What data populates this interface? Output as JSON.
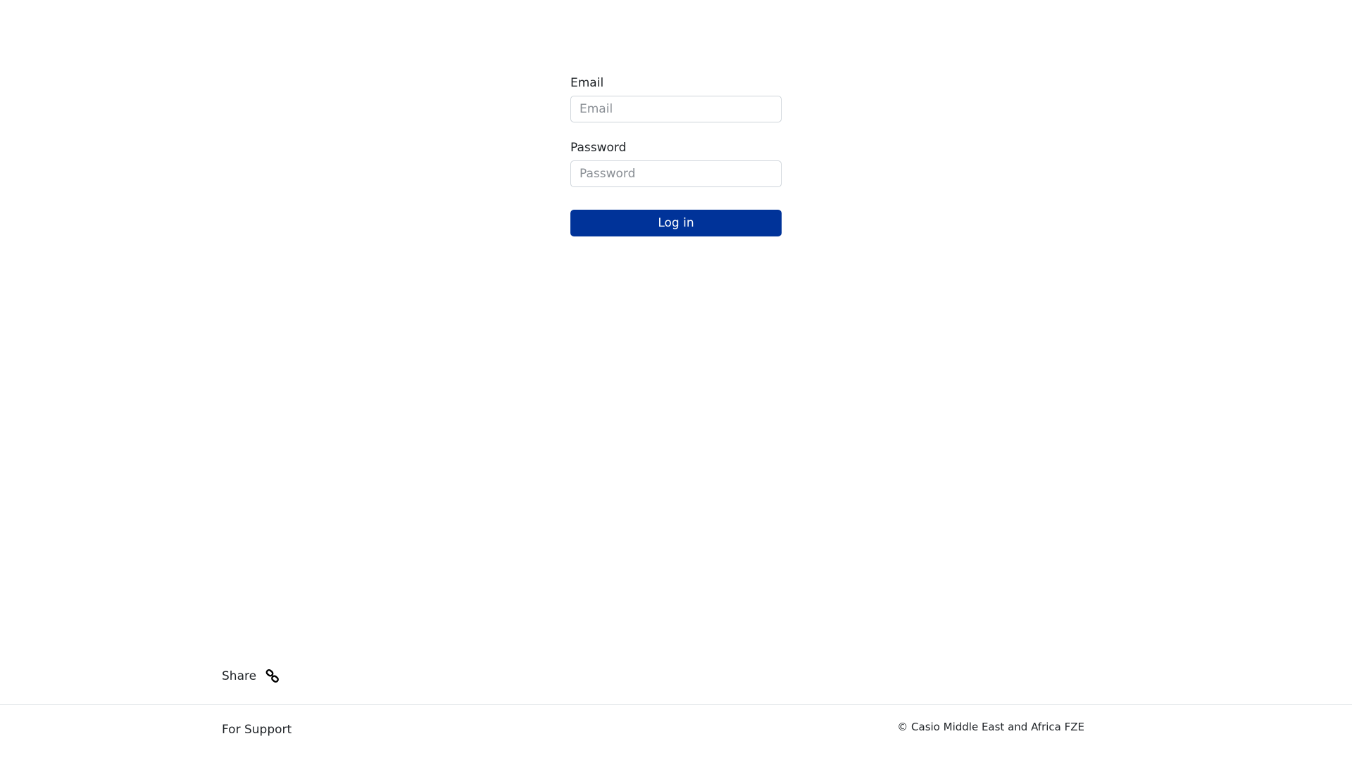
{
  "login": {
    "email_label": "Email",
    "email_placeholder": "Email",
    "email_value": "",
    "password_label": "Password",
    "password_placeholder": "Password",
    "password_value": "",
    "submit_label": "Log in"
  },
  "share": {
    "label": "Share",
    "icon": "link-icon"
  },
  "footer": {
    "support_label": "For Support",
    "copyright": "© Casio Middle East and Africa FZE"
  },
  "colors": {
    "primary_button": "#003399",
    "button_text": "#ffffff",
    "input_border": "#ced4da",
    "footer_border": "#dee2e6"
  }
}
